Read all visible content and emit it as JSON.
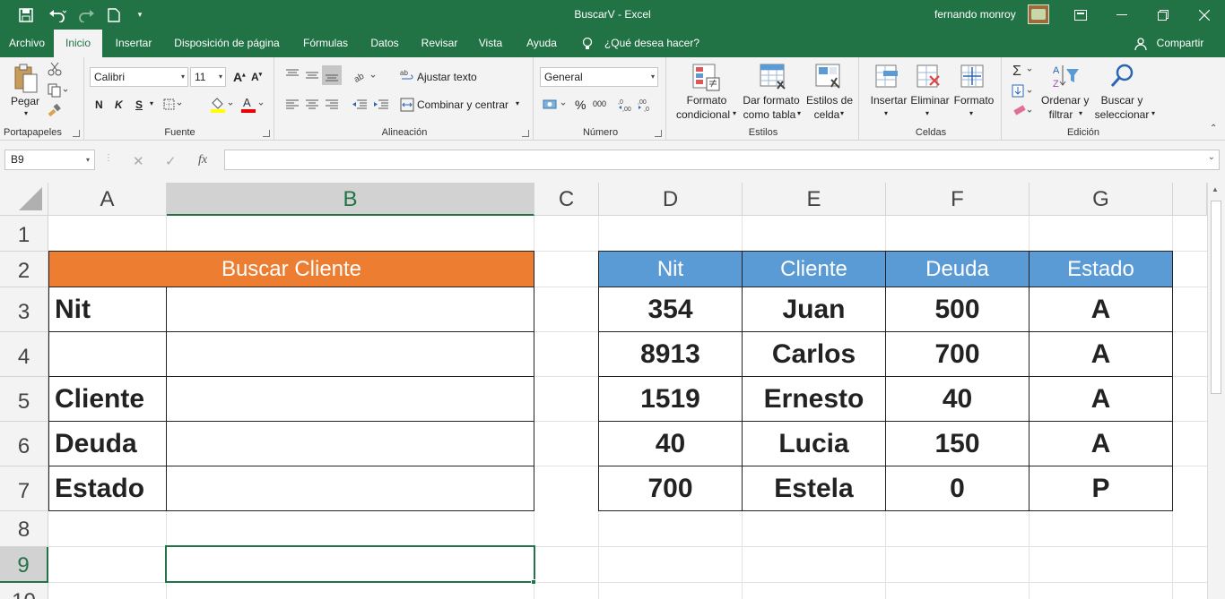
{
  "window": {
    "title": "BuscarV  -  Excel",
    "user": "fernando monroy"
  },
  "tabs": [
    "Archivo",
    "Inicio",
    "Insertar",
    "Disposición de página",
    "Fórmulas",
    "Datos",
    "Revisar",
    "Vista",
    "Ayuda",
    "¿Qué desea hacer?"
  ],
  "share_label": "Compartir",
  "ribbon": {
    "clipboard": {
      "paste": "Pegar",
      "group": "Portapapeles"
    },
    "font": {
      "name": "Calibri",
      "size": "11",
      "bold": "N",
      "italic": "K",
      "underline": "S",
      "group": "Fuente"
    },
    "alignment": {
      "wrap": "Ajustar texto",
      "merge": "Combinar y centrar",
      "group": "Alineación"
    },
    "number": {
      "format": "General",
      "percent": "%",
      "thousands": "000",
      "group": "Número"
    },
    "styles": {
      "conditional_1": "Formato",
      "conditional_2": "condicional",
      "table_1": "Dar formato",
      "table_2": "como tabla",
      "cell_1": "Estilos de",
      "cell_2": "celda",
      "group": "Estilos"
    },
    "cells": {
      "insert": "Insertar",
      "delete": "Eliminar",
      "format": "Formato",
      "group": "Celdas"
    },
    "editing": {
      "sort_1": "Ordenar y",
      "sort_2": "filtrar",
      "find_1": "Buscar y",
      "find_2": "seleccionar",
      "group": "Edición"
    }
  },
  "formula_bar": {
    "name_box": "B9",
    "formula": "",
    "fx": "fx"
  },
  "columns": [
    "A",
    "B",
    "C",
    "D",
    "E",
    "F",
    "G"
  ],
  "rows": [
    "1",
    "2",
    "3",
    "4",
    "5",
    "6",
    "7",
    "8",
    "9",
    "10"
  ],
  "search_form": {
    "header": "Buscar Cliente",
    "labels": [
      "Nit",
      "",
      "Cliente",
      "Deuda",
      "Estado"
    ]
  },
  "table": {
    "headers": [
      "Nit",
      "Cliente",
      "Deuda",
      "Estado"
    ],
    "rows": [
      [
        "354",
        "Juan",
        "500",
        "A"
      ],
      [
        "8913",
        "Carlos",
        "700",
        "A"
      ],
      [
        "1519",
        "Ernesto",
        "40",
        "A"
      ],
      [
        "40",
        "Lucia",
        "150",
        "A"
      ],
      [
        "700",
        "Estela",
        "0",
        "P"
      ]
    ]
  },
  "colors": {
    "excel_green": "#217346",
    "header_orange": "#ed7d31",
    "table_blue": "#5b9bd5"
  }
}
